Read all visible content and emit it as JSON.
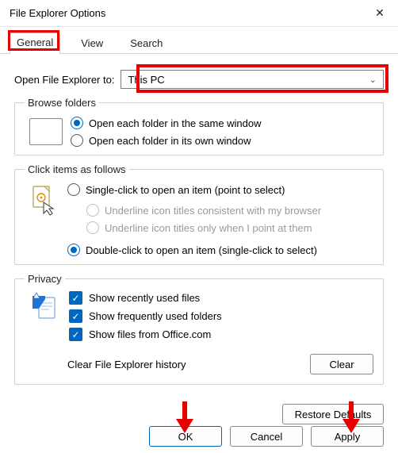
{
  "window": {
    "title": "File Explorer Options",
    "close_glyph": "✕"
  },
  "tabs": {
    "general": "General",
    "view": "View",
    "search": "Search"
  },
  "open_to": {
    "label": "Open File Explorer to:",
    "value": "This PC"
  },
  "browse": {
    "legend": "Browse folders",
    "same_window": "Open each folder in the same window",
    "own_window": "Open each folder in its own window"
  },
  "click": {
    "legend": "Click items as follows",
    "single": "Single-click to open an item (point to select)",
    "underline_browser": "Underline icon titles consistent with my browser",
    "underline_point": "Underline icon titles only when I point at them",
    "double": "Double-click to open an item (single-click to select)"
  },
  "privacy": {
    "legend": "Privacy",
    "recent": "Show recently used files",
    "frequent": "Show frequently used folders",
    "office": "Show files from Office.com",
    "clear_label": "Clear File Explorer history",
    "clear_btn": "Clear"
  },
  "buttons": {
    "restore": "Restore Defaults",
    "ok": "OK",
    "cancel": "Cancel",
    "apply": "Apply"
  },
  "icons": {
    "chevron_down": "⌄",
    "check": "✓"
  },
  "annotations": {
    "highlight_general_tab": true,
    "highlight_dropdown": true,
    "arrow_ok": true,
    "arrow_apply": true
  }
}
